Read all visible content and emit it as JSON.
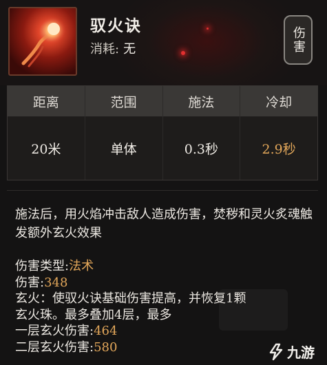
{
  "skill": {
    "name": "驭火诀",
    "cost_label": "消耗:",
    "cost_value": "无",
    "tag": "伤害",
    "icon": "fire-spirit-icon"
  },
  "stats": {
    "headers": [
      "距离",
      "范围",
      "施法",
      "冷却"
    ],
    "values": [
      "20米",
      "单体",
      "0.3秒",
      "2.9秒"
    ]
  },
  "description": "施法后，用火焰冲击敌人造成伤害，焚秽和灵火炙魂触发额外玄火效果",
  "attributes": {
    "damage_type_label": "伤害类型:",
    "damage_type_value": "法术",
    "damage_label": "伤害:",
    "damage_value": "348",
    "xuanhuo_line1": "玄火：使驭火诀基础伤害提高，并恢复1颗",
    "xuanhuo_line2": "玄火珠。最多叠加4层，最多",
    "level1_label": "一层玄火伤害:",
    "level1_value": "464",
    "level2_label": "二层玄火伤害:",
    "level2_value": "580"
  },
  "watermark": {
    "text": "九游",
    "icon": "jiuyou-logo-icon"
  },
  "colors": {
    "accent": "#e3a75a",
    "background": "#141313",
    "header_bg": "#3a3836"
  }
}
